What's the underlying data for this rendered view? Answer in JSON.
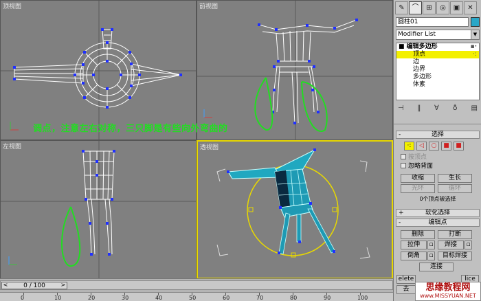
{
  "viewports": {
    "top": {
      "label": "顶视图"
    },
    "front": {
      "label": "前视图"
    },
    "left": {
      "label": "左视图"
    },
    "perspective": {
      "label": "透视图"
    }
  },
  "annotation": "调点，注意左右对称，三只脚是有些向外弯曲的",
  "timeline": {
    "frame_display": "0 / 100",
    "ticks": [
      "0",
      "10",
      "20",
      "30",
      "40",
      "50",
      "60",
      "70",
      "80",
      "90",
      "100"
    ],
    "prev_label": "<",
    "next_label": ">"
  },
  "panel": {
    "object_name": "圆柱01",
    "object_color": "#2aa7c8",
    "modifier_list_placeholder": "Modifier List",
    "modifier_stack": [
      {
        "label": "■ 编辑多边形",
        "selected": false
      },
      {
        "label": "顶点",
        "selected": true
      },
      {
        "label": "边",
        "selected": false
      },
      {
        "label": "边界",
        "selected": false
      },
      {
        "label": "多边形",
        "selected": false
      },
      {
        "label": "体素",
        "selected": false
      }
    ],
    "selection_rollout": "选择",
    "by_vertex": "按顶点",
    "ignore_backfacing": "忽略背面",
    "shrink": "收缩",
    "grow": "生长",
    "ring": "光环",
    "loop": "循环",
    "selected_info": "0个顶点被选择",
    "soft_selection_rollout": "软化选择",
    "edit_vertices_rollout": "编辑点",
    "remove": "删除",
    "break": "打断",
    "extrude": "拉伸",
    "weld": "焊接",
    "chamfer": "倒角",
    "target_weld": "目标焊接",
    "connect": "连接",
    "delete_iso": "elete",
    "slice": "lice",
    "remove_iso": "去"
  },
  "watermark": {
    "line1": "思缘教程网",
    "line2": "www.MISSYUAN.NET"
  },
  "colors": {
    "viewport_bg": "#808080",
    "mesh_white": "#ffffff",
    "vertex_blue": "#2030ff",
    "green_stroke": "#22dd22",
    "active_border": "#e8d800",
    "selected_row": "#f3f000"
  }
}
